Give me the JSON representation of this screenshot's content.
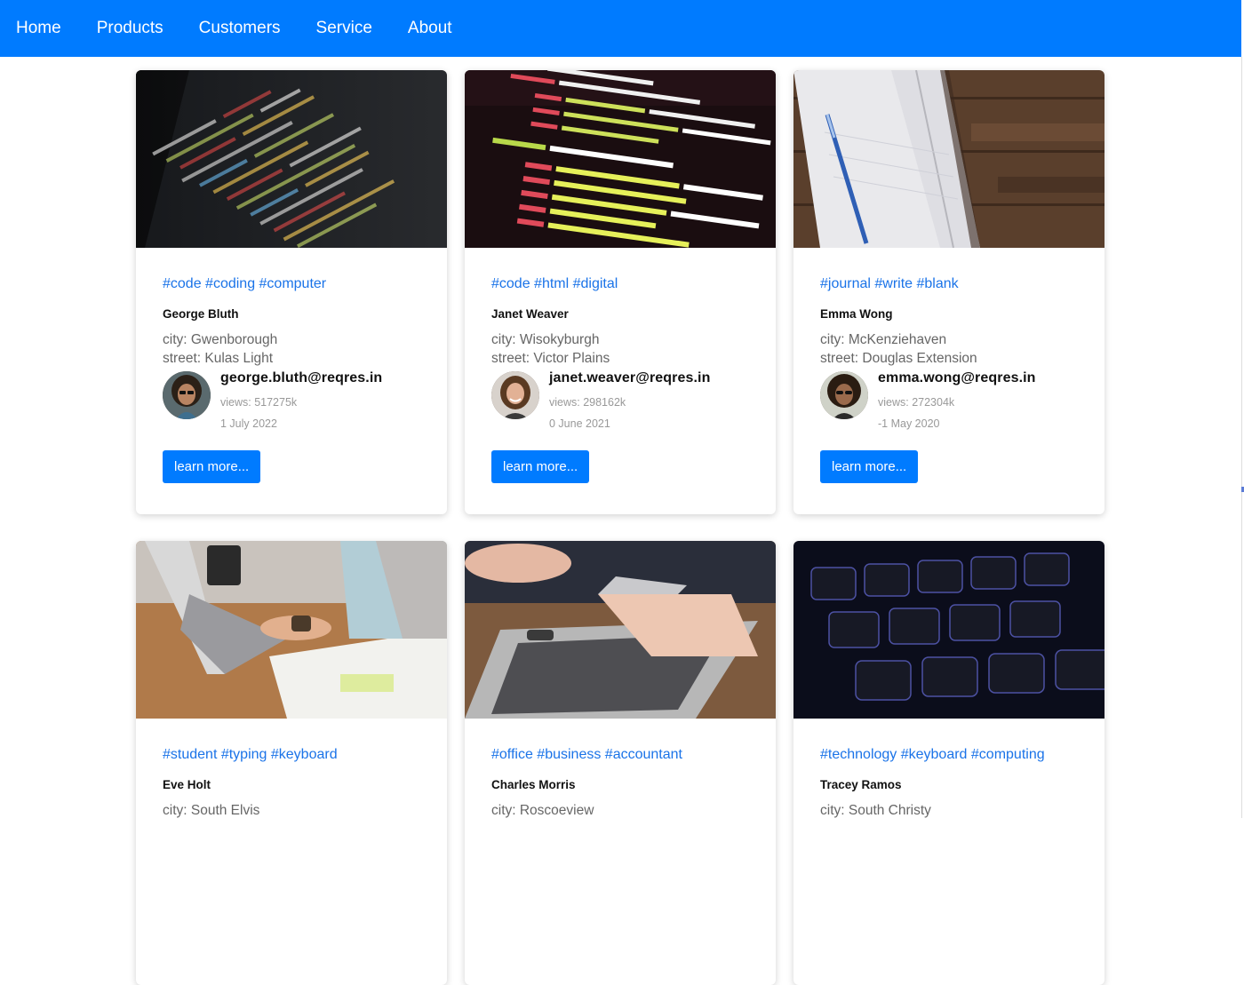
{
  "nav": [
    "Home",
    "Products",
    "Customers",
    "Service",
    "About"
  ],
  "cards": [
    {
      "tags": "#code #coding #computer",
      "name": "George Bluth",
      "city": "city: Gwenborough",
      "street": "street: Kulas Light",
      "email": "george.bluth@reqres.in",
      "views": "views: 517275k",
      "date": "1 July 2022",
      "button": "learn more..."
    },
    {
      "tags": "#code #html #digital",
      "name": "Janet Weaver",
      "city": "city: Wisokyburgh",
      "street": "street: Victor Plains",
      "email": "janet.weaver@reqres.in",
      "views": "views: 298162k",
      "date": "0 June 2021",
      "button": "learn more..."
    },
    {
      "tags": "#journal #write #blank",
      "name": "Emma Wong",
      "city": "city: McKenziehaven",
      "street": "street: Douglas Extension",
      "email": "emma.wong@reqres.in",
      "views": "views: 272304k",
      "date": "-1 May 2020",
      "button": "learn more..."
    },
    {
      "tags": "#student #typing #keyboard",
      "name": "Eve Holt",
      "city": "city: South Elvis",
      "street": "",
      "email": "",
      "views": "",
      "date": "",
      "button": ""
    },
    {
      "tags": "#office #business #accountant",
      "name": "Charles Morris",
      "city": "city: Roscoeview",
      "street": "",
      "email": "",
      "views": "",
      "date": "",
      "button": ""
    },
    {
      "tags": "#technology #keyboard #computing",
      "name": "Tracey Ramos",
      "city": "city: South Christy",
      "street": "",
      "email": "",
      "views": "",
      "date": "",
      "button": ""
    }
  ],
  "colors": {
    "accent": "#007bff",
    "tag": "#1a73e8"
  },
  "icons": [
    "code-screen-image",
    "code-screen-image",
    "notebook-image",
    "laptop-typing-image",
    "phone-laptop-image",
    "keyboard-image"
  ]
}
